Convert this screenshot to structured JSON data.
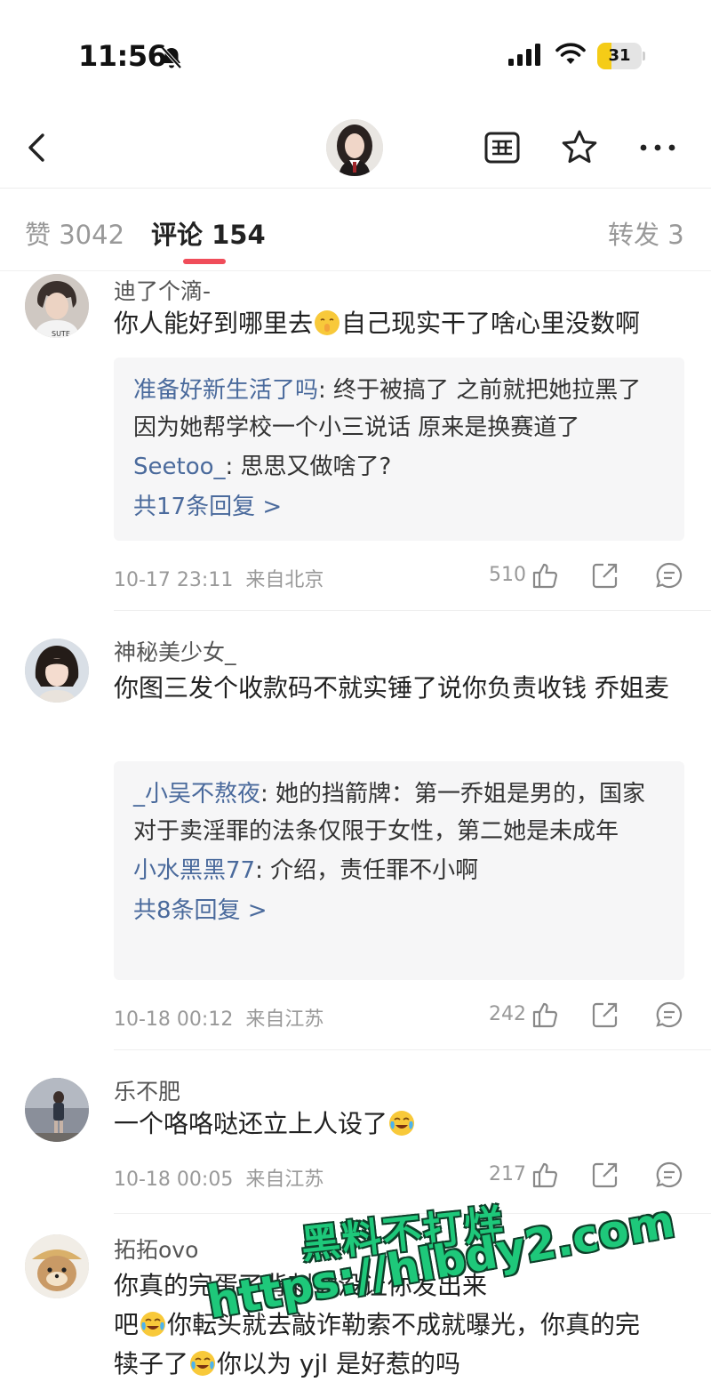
{
  "status_bar": {
    "time": "11:56",
    "battery": "31",
    "battery_level": 0.31,
    "icons": [
      "bell-off-icon",
      "signal-icon",
      "wifi-icon",
      "battery-icon"
    ]
  },
  "nav": {
    "icons": [
      "back-icon",
      "avatar",
      "list-icon",
      "star-icon",
      "more-icon"
    ]
  },
  "tabs": {
    "likes": "赞 3042",
    "comments": "评论 154",
    "reposts": "转发 3"
  },
  "comments": [
    {
      "username": "迪了个滴-",
      "text_before": "你人能好到哪里去",
      "text_after": "自己现实干了啥心里没数啊",
      "emoji": "shushing-face-emoji",
      "replies": [
        {
          "name": "准备好新生活了吗",
          "text": ": 终于被搞了 之前就把她拉黑了 因为她帮学校一个小三说话 原来是换赛道了"
        },
        {
          "name": "Seetoo_",
          "text": ": 思思又做啥了?"
        }
      ],
      "more_replies": "共17条回复 >",
      "time": "10-17 23:11",
      "location": "来自北京",
      "likes": "510"
    },
    {
      "username": "神秘美少女_",
      "text_before": "你图三发个收款码不就实锤了说你负责收钱 乔姐麦",
      "text_after": "",
      "replies": [
        {
          "name": "_小吴不熬夜",
          "text": ": 她的挡箭牌：第一乔姐是男的，国家对于卖淫罪的法条仅限于女性，第二她是未成年"
        },
        {
          "name": "小水黑黑77",
          "text": ": 介绍，责任罪不小啊"
        }
      ],
      "more_replies": "共8条回复 >",
      "time": "10-18 00:12",
      "location": "来自江苏",
      "likes": "242"
    },
    {
      "username": "乐不肥",
      "text_before": "一个咯咯哒还立上人设了",
      "emoji": "crying-laughing-emoji",
      "time": "10-18 00:05",
      "location": "来自江苏",
      "likes": "217"
    },
    {
      "username": "拓拓ovo",
      "line1": "你真的完蛋了背刺",
      "line1_end": "你没让你发出来",
      "line2a": "吧",
      "line2b": "你転头就去敲诈勒索不成就曝光，你真的完",
      "line3a": "犊子了",
      "line3b": "你以为 yjl 是好惹的吗",
      "emoji": "crying-laughing-emoji"
    }
  ],
  "watermark": {
    "line1": "黑料不打烊",
    "line2": "https://hlbdy2.com"
  }
}
